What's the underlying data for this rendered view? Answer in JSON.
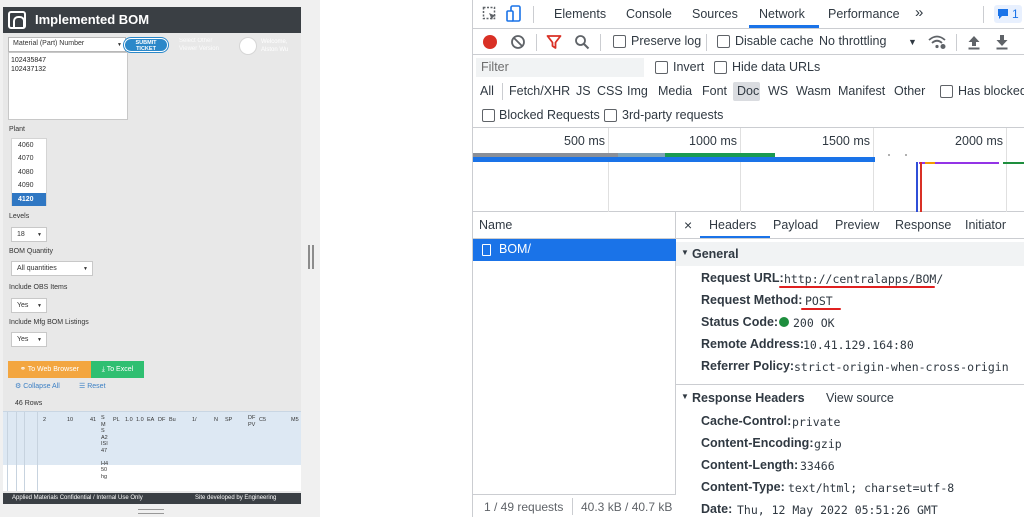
{
  "app": {
    "title": "Implemented BOM",
    "material_select": "Material (Part) Number",
    "submit_ticket": "SUBMIT TICKET",
    "select_other": "Select Other\nViewer Version",
    "welcome": "Welcome,\nAlston Wu",
    "part_numbers": [
      "102435847",
      "102437132"
    ],
    "plant_label": "Plant",
    "plants": [
      "4060",
      "4070",
      "4080",
      "4090",
      "4120"
    ],
    "selected_plant": "4120",
    "levels_label": "Levels",
    "levels_value": "18",
    "bom_quantity_label": "BOM Quantity",
    "bom_quantity_value": "All quantities",
    "obs_label": "Include OBS Items",
    "obs_value": "Yes",
    "mfg_label": "Include Mfg BOM Listings",
    "mfg_value": "Yes",
    "web_browser_button": "To Web Browser",
    "excel_button": "To Excel",
    "collapse_all": "Collapse All",
    "reset": "Reset",
    "row_count": "46 Rows",
    "table_cells": [
      "2",
      "10",
      "41",
      "S\nM\nS\nA2\nISI\n47\n\nH4\n50\nhg",
      "PL",
      "1.0",
      "1.0",
      "EA",
      "DF",
      "Bu",
      "1/",
      "N",
      "SP",
      "DF\nPV",
      "C5",
      "M5"
    ],
    "footer_left": "Applied Materials Confidential / Internal Use Only",
    "footer_right": "Site developed by Engineering"
  },
  "devtools": {
    "tabs": [
      "Elements",
      "Console",
      "Sources",
      "Network",
      "Performance"
    ],
    "active_tab": "Network",
    "more_tabs": "»",
    "issues_badge": "1",
    "toolbar": {
      "preserve_log": "Preserve log",
      "disable_cache": "Disable cache",
      "throttling": "No throttling"
    },
    "filter_placeholder": "Filter",
    "invert": "Invert",
    "hide_data_urls": "Hide data URLs",
    "types": [
      "All",
      "Fetch/XHR",
      "JS",
      "CSS",
      "Img",
      "Media",
      "Font",
      "Doc",
      "WS",
      "Wasm",
      "Manifest",
      "Other"
    ],
    "active_type": "Doc",
    "has_blocked": "Has blocked",
    "blocked_requests": "Blocked Requests",
    "third_party": "3rd-party requests",
    "timeline_ticks": [
      "500 ms",
      "1000 ms",
      "1500 ms",
      "2000 ms"
    ],
    "name_header": "Name",
    "request_name": "BOM/",
    "detail_tabs": [
      "Headers",
      "Payload",
      "Preview",
      "Response",
      "Initiator"
    ],
    "active_detail_tab": "Headers",
    "general": {
      "title": "General",
      "request_url_label": "Request URL:",
      "request_url": "http://centralapps/BOM/",
      "request_method_label": "Request Method:",
      "request_method": "POST",
      "status_code_label": "Status Code:",
      "status_code": "200 OK",
      "remote_address_label": "Remote Address:",
      "remote_address": "10.41.129.164:80",
      "referrer_policy_label": "Referrer Policy:",
      "referrer_policy": "strict-origin-when-cross-origin"
    },
    "response_headers": {
      "title": "Response Headers",
      "view_source": "View source",
      "cache_control_label": "Cache-Control:",
      "cache_control": "private",
      "content_encoding_label": "Content-Encoding:",
      "content_encoding": "gzip",
      "content_length_label": "Content-Length:",
      "content_length": "33466",
      "content_type_label": "Content-Type:",
      "content_type": "text/html; charset=utf-8",
      "date_label": "Date:",
      "date": "Thu, 12 May 2022 05:51:26 GMT"
    },
    "status_bar": {
      "requests": "1 / 49 requests",
      "transferred": "40.3 kB / 40.7 kB"
    },
    "colors": {
      "accent": "#1a73e8",
      "record": "#d93025",
      "status_ok": "#1e8e3e",
      "annotation": "#e02020"
    }
  }
}
